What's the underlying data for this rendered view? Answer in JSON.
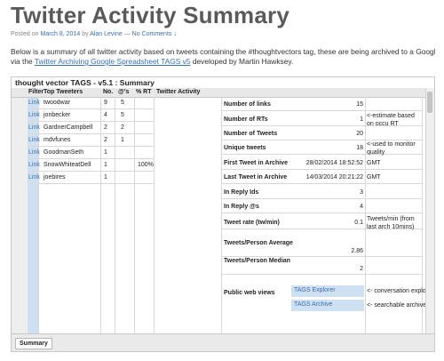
{
  "page": {
    "title": "Twitter Activity Summary",
    "meta": {
      "posted_on": "Posted on",
      "date": "March 8, 2014",
      "by": "by",
      "author": "Alan Levine",
      "sep": "—",
      "comments": "No Comments ↓"
    },
    "description": {
      "line1": "Below is a summary of all twitter activity based on tweets containing the #thoughtvectors tag, these are being archived to a Google document",
      "line2_pre": "via the",
      "link": "Twitter Archiving Google Spreadsheet TAGS v5",
      "line2_post": "developed by Martin Hawksey."
    }
  },
  "sheet": {
    "title": "thought vector TAGS - v5.1 : Summary",
    "headers": {
      "filter": "Filter",
      "top_tweeters": "Top Tweeters",
      "no": "No.",
      "ats": "@'s",
      "pct_rt": "% RT",
      "twitter_activity": "Twitter Activity"
    },
    "tweeters": [
      {
        "link": "Link",
        "name": "twoodwar",
        "no": "9",
        "ats": "5",
        "pct_rt": ""
      },
      {
        "link": "Link",
        "name": "jonbecker",
        "no": "4",
        "ats": "5",
        "pct_rt": ""
      },
      {
        "link": "Link",
        "name": "GardnerCampbell",
        "no": "2",
        "ats": "2",
        "pct_rt": ""
      },
      {
        "link": "Link",
        "name": "mdvfunes",
        "no": "2",
        "ats": "1",
        "pct_rt": ""
      },
      {
        "link": "Link",
        "name": "GoodmanSeth",
        "no": "1",
        "ats": "",
        "pct_rt": ""
      },
      {
        "link": "Link",
        "name": "SnowWhiteatDell",
        "no": "1",
        "ats": "",
        "pct_rt": "100%"
      },
      {
        "link": "Link",
        "name": "joebires",
        "no": "1",
        "ats": "",
        "pct_rt": ""
      }
    ],
    "stats": [
      {
        "label": "Number of links",
        "value": "15",
        "note": ""
      },
      {
        "label": "Number of RTs",
        "value": "1",
        "note": "<-estimate based on occu RT"
      },
      {
        "label": "Number of Tweets",
        "value": "20",
        "note": ""
      },
      {
        "label": "Unique tweets",
        "value": "18",
        "note": "<-used to monitor quality"
      },
      {
        "label": "First Tweet in Archive",
        "value": "28/02/2014 18:52:52",
        "note": "GMT"
      },
      {
        "label": "Last Tweet in Archive",
        "value": "14/03/2014 20:21:22",
        "note": "GMT"
      },
      {
        "label": "In Reply Ids",
        "value": "3",
        "note": ""
      },
      {
        "label": "In Reply @s",
        "value": "4",
        "note": ""
      },
      {
        "label": "Tweet rate (tw/min)",
        "value": "0.1",
        "note": "Tweets/min (from last arch 10mins)"
      },
      {
        "label": "Tweets/Person Average",
        "value": "2.86",
        "note": ""
      },
      {
        "label": "Tweets/Person Median",
        "value": "2",
        "note": ""
      }
    ],
    "public_views": {
      "label": "Public web views",
      "items": [
        {
          "name": "TAGS Explorer",
          "note": "<- conversation explorer"
        },
        {
          "name": "TAGS Archive",
          "note": "<- searchable archive"
        }
      ]
    },
    "tab": "Summary"
  }
}
